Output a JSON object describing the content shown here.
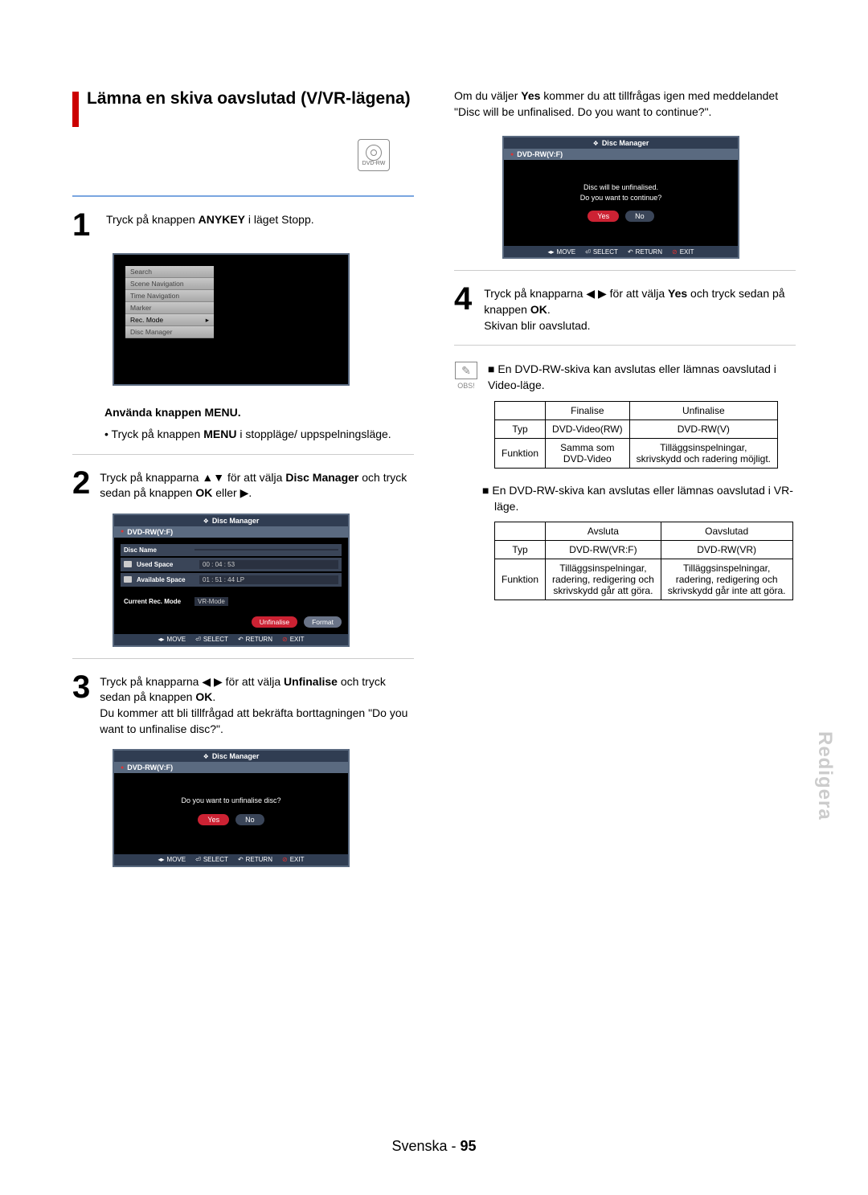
{
  "sideTab": "Redigera",
  "footer": {
    "lang": "Svenska",
    "dash": " - ",
    "page": "95"
  },
  "section": {
    "title": "Lämna en skiva oavslutad (V/VR-lägena)",
    "badgeLabel": "DVD-RW"
  },
  "step1": {
    "num": "1",
    "line1": "Tryck på knappen ",
    "bold": "ANYKEY",
    "line2": " i läget Stopp."
  },
  "sub1": {
    "heading": "Använda knappen MENU.",
    "bullet_pre": "• Tryck på knappen ",
    "bullet_bold": "MENU",
    "bullet_post": " i stoppläge/ uppspelningsläge."
  },
  "step2": {
    "num": "2",
    "a": "Tryck på knapparna ▲▼ för att välja ",
    "b1": "Disc Manager",
    "c": " och tryck sedan på knappen ",
    "b2": "OK",
    "d": " eller ▶."
  },
  "step3": {
    "num": "3",
    "a": "Tryck på knapparna ◀ ▶ för att välja ",
    "b1": "Unfinalise",
    "c": " och tryck sedan på knappen ",
    "b2": "OK",
    "d": ".",
    "e": "Du kommer att bli tillfrågad att bekräfta borttagningen \"Do you want to unfinalise disc?\"."
  },
  "rightIntro": "Om du väljer Yes kommer du att tillfrågas igen med meddelandet \"Disc will be unfinalised. Do you want to continue?\".",
  "rightIntro_boldWord": "Yes",
  "step4": {
    "num": "4",
    "a": "Tryck på knapparna ◀ ▶ för att välja ",
    "b1": "Yes",
    "c": " och tryck sedan på knappen ",
    "b2": "OK",
    "d": ".",
    "e": "Skivan blir oavslutad."
  },
  "note": {
    "label": "OBS!",
    "text": "En DVD-RW-skiva kan avslutas eller lämnas oavslutad i Video-läge."
  },
  "table1": {
    "h1": "",
    "h2": "Finalise",
    "h3": "Unfinalise",
    "r1c1": "Typ",
    "r1c2": "DVD-Video(RW)",
    "r1c3": "DVD-RW(V)",
    "r2c1": "Funktion",
    "r2c2a": "Samma som",
    "r2c2b": "DVD-Video",
    "r2c3a": "Tilläggsinspelningar,",
    "r2c3b": "skrivskydd och radering möjligt."
  },
  "bullet2": "En DVD-RW-skiva kan avslutas eller lämnas oavslutad i VR-läge.",
  "table2": {
    "h1": "",
    "h2": "Avsluta",
    "h3": "Oavslutad",
    "r1c1": "Typ",
    "r1c2": "DVD-RW(VR:F)",
    "r1c3": "DVD-RW(VR)",
    "r2c1": "Funktion",
    "r2c2a": "Tilläggsinspelningar,",
    "r2c2b": "radering, redigering och",
    "r2c2c": "skrivskydd går att göra.",
    "r2c3a": "Tilläggsinspelningar,",
    "r2c3b": "radering, redigering och",
    "r2c3c": "skrivskydd går inte att göra."
  },
  "ss1": {
    "items": [
      "Search",
      "Scene Navigation",
      "Time Navigation",
      "Marker",
      "Rec. Mode",
      "Disc Manager"
    ],
    "selectedIndex": 4
  },
  "ss2": {
    "topTitle": "Disc Manager",
    "header": "DVD-RW(V:F)",
    "rows": [
      {
        "label": "Disc Name",
        "val": ""
      },
      {
        "label": "Used Space",
        "val": "00 : 04 : 53"
      },
      {
        "label": "Available Space",
        "val": "01 : 51 : 44 LP"
      },
      {
        "label": "Current Rec. Mode",
        "val": "VR-Mode"
      }
    ],
    "pill1": "Unfinalise",
    "pill2": "Format",
    "nav": {
      "move": "MOVE",
      "select": "SELECT",
      "return": "RETURN",
      "exit": "EXIT"
    }
  },
  "ss3": {
    "topTitle": "Disc Manager",
    "header": "DVD-RW(V:F)",
    "dialog": "Do you want to unfinalise disc?",
    "yes": "Yes",
    "no": "No",
    "nav": {
      "move": "MOVE",
      "select": "SELECT",
      "return": "RETURN",
      "exit": "EXIT"
    }
  },
  "ss4": {
    "topTitle": "Disc Manager",
    "header": "DVD-RW(V:F)",
    "dialog1": "Disc will be unfinalised.",
    "dialog2": "Do you want to continue?",
    "yes": "Yes",
    "no": "No",
    "nav": {
      "move": "MOVE",
      "select": "SELECT",
      "return": "RETURN",
      "exit": "EXIT"
    }
  }
}
